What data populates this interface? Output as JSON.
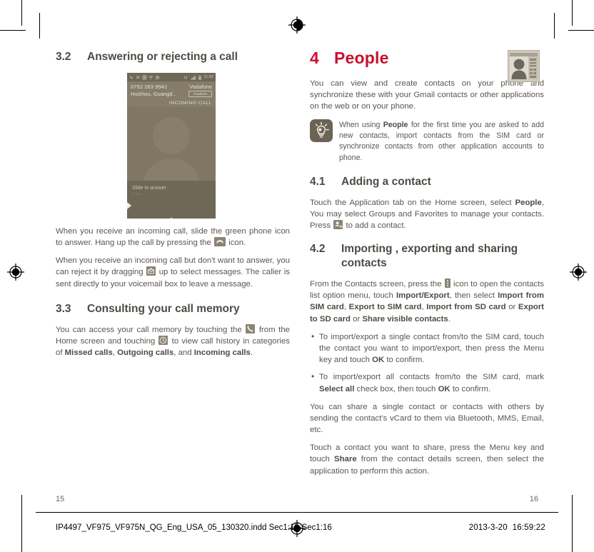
{
  "document": {
    "left_page_number": "15",
    "right_page_number": "16",
    "footer_filename": "IP4497_VF975_VF975N_QG_Eng_USA_05_130320.indd   Sec1:15-Sec1:16",
    "footer_date": "2013-3-20",
    "footer_time": "16:59:22",
    "accent_color": "#c8102e",
    "body_color": "#5b5650",
    "heading_color": "#4f4a44"
  },
  "left_column": {
    "section_3_2": {
      "number": "3.2",
      "title": "Answering or rejecting a call",
      "screenshot": {
        "name": "incoming-call-screen",
        "status_time": "11:02",
        "phone_number": "0752 263 9941",
        "location": "Huizhou, Guangd...",
        "carrier": "Vodafone",
        "carrier_badge": "Vodafone",
        "call_state": "INCOMING CALL",
        "slide_label": "Slide to answer",
        "slide_arrows": ">>>"
      },
      "paragraph_1_a": "When you receive an incoming call, slide the green phone icon to answer. Hang up the call by pressing the",
      "paragraph_1_icon": "end-call-icon",
      "paragraph_1_b": "icon.",
      "paragraph_2_a": "When you receive an incoming call but don't want to answer, you can reject it by dragging",
      "paragraph_2_icon": "message-reject-icon",
      "paragraph_2_b": "up to select messages. The caller is sent directly to your voicemail box to leave a message."
    },
    "section_3_3": {
      "number": "3.3",
      "title": "Consulting your call memory",
      "paragraph_a": "You can access your call memory by touching the",
      "icon_1": "phone-handset-icon",
      "paragraph_b": "from the Home screen and touching",
      "icon_2": "clock-history-icon",
      "paragraph_c": "to view call history in categories of",
      "bold_1": "Missed calls",
      "paragraph_d": ",",
      "bold_2": "Outgoing calls",
      "paragraph_e": ", and",
      "bold_3": "Incoming calls",
      "paragraph_f": "."
    }
  },
  "right_column": {
    "chapter": {
      "number": "4",
      "title": "People",
      "icon_name": "people-contacts-icon"
    },
    "intro": "You can view and create contacts on your phone and synchronize these with your Gmail contacts or other applications on the web or on your phone.",
    "tip": {
      "icon_name": "lightbulb-tip-icon",
      "text_a": "When using",
      "bold": "People",
      "text_b": "for the first time you are asked to add new contacts, import contacts from the SIM card or synchronize contacts from other application accounts to phone."
    },
    "section_4_1": {
      "number": "4.1",
      "title": "Adding a contact",
      "paragraph_a": "Touch the Application tab on the Home screen, select",
      "bold_1": "People",
      "paragraph_b": ", You may select Groups and Favorites to manage your contacts. Press",
      "icon": "add-contact-icon",
      "paragraph_c": "to add a contact."
    },
    "section_4_2": {
      "number": "4.2",
      "title_line_1": "Importing , exporting and sharing",
      "title_line_2": "contacts",
      "paragraph_a": "From the Contacts screen, press the",
      "icon": "overflow-menu-icon",
      "paragraph_b": "icon to open the contacts list option menu, touch",
      "bold_1": "Import/Export",
      "paragraph_c": ", then select",
      "bold_2": "Import from SIM card",
      "paragraph_d": ",",
      "bold_3": "Export to SIM card",
      "paragraph_e": ",",
      "bold_4": "Import from SD card",
      "paragraph_f": "or",
      "bold_5": "Export to SD card",
      "paragraph_g": "or",
      "bold_6": "Share visible contacts",
      "paragraph_h": ".",
      "bullets": [
        {
          "text_a": "To import/export a single contact from/to the SIM card, touch the contact you want to import/export, then press the Menu key and touch",
          "bold": "OK",
          "text_b": "to confirm."
        },
        {
          "text_a": "To import/export all contacts from/to the SIM card, mark",
          "bold": "Select all",
          "text_b": "check box, then touch",
          "bold_2": "OK",
          "text_c": "to confirm."
        }
      ],
      "paragraph_share_1": "You can share a single contact or contacts with others by sending the contact's vCard to them via Bluetooth, MMS, Email, etc.",
      "paragraph_share_2_a": "Touch a contact you want to share, press the Menu key and touch",
      "paragraph_share_2_bold": "Share",
      "paragraph_share_2_b": "from the contact details screen, then select the application to perform this action."
    }
  }
}
